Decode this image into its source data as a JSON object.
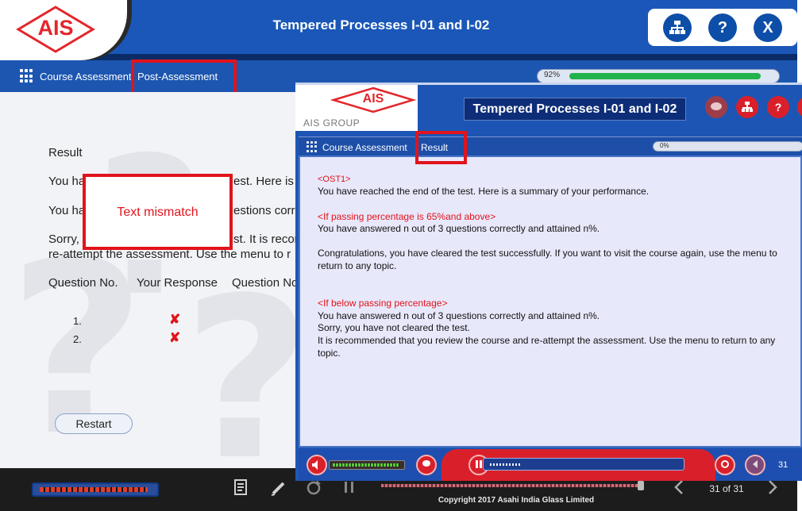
{
  "course": {
    "logo_text": "AIS",
    "title": "Tempered Processes I-01 and I-02",
    "tools": [
      {
        "icon": "sitemap-icon",
        "label": ""
      },
      {
        "icon": "help-icon",
        "label": "?"
      },
      {
        "icon": "close-icon",
        "label": "X"
      }
    ],
    "breadcrumb": {
      "section": "Course Assessment",
      "page": "Post-Assessment"
    },
    "progress": {
      "label": "92%",
      "value": 0.92
    },
    "content": {
      "heading": "Result",
      "line1_start": "You ha",
      "line1_end": "est. Here is a",
      "line2_start": "You ha",
      "line2_end": "estions corre",
      "line3_start": "Sorry,",
      "line3_end": "st. It is recor",
      "line4": "re-attempt the assessment. Use the menu to r",
      "table_headers": [
        "Question No.",
        "Your Response",
        "Question No"
      ],
      "rows": [
        {
          "number": "1.",
          "response": "✘"
        },
        {
          "number": "2.",
          "response": "✘"
        }
      ],
      "restart_label": "Restart"
    },
    "annotation": "Text mismatch",
    "footer": {
      "page": "31 of 31",
      "copyright": "Copyright 2017 Asahi India Glass Limited"
    }
  },
  "reference": {
    "logo_text": "AIS",
    "group_text": "AIS GROUP",
    "title": "Tempered Processes  I-01 and  I-02",
    "breadcrumb": {
      "section": "Course Assessment",
      "page": "Result"
    },
    "progress_label": "0%",
    "content": {
      "tag": "<OST1>",
      "intro": "You have reached the end of the test. Here is a summary of your performance.",
      "pass_condition": "<If passing percentage is 65%and above>",
      "pass_score": "You have answered n out of 3 questions correctly and attained n%.",
      "pass_message": "Congratulations, you have cleared the test successfully. If you want to visit the course again, use the menu to return to any topic.",
      "fail_condition": "<If below passing percentage>",
      "fail_score": "You have answered n out of 3 questions correctly and attained n%.",
      "fail_message1": "Sorry, you have not cleared the test.",
      "fail_message2": "It is recommended that you review the course and re-attempt the assessment. Use the menu to return to any topic."
    },
    "page": "31"
  }
}
